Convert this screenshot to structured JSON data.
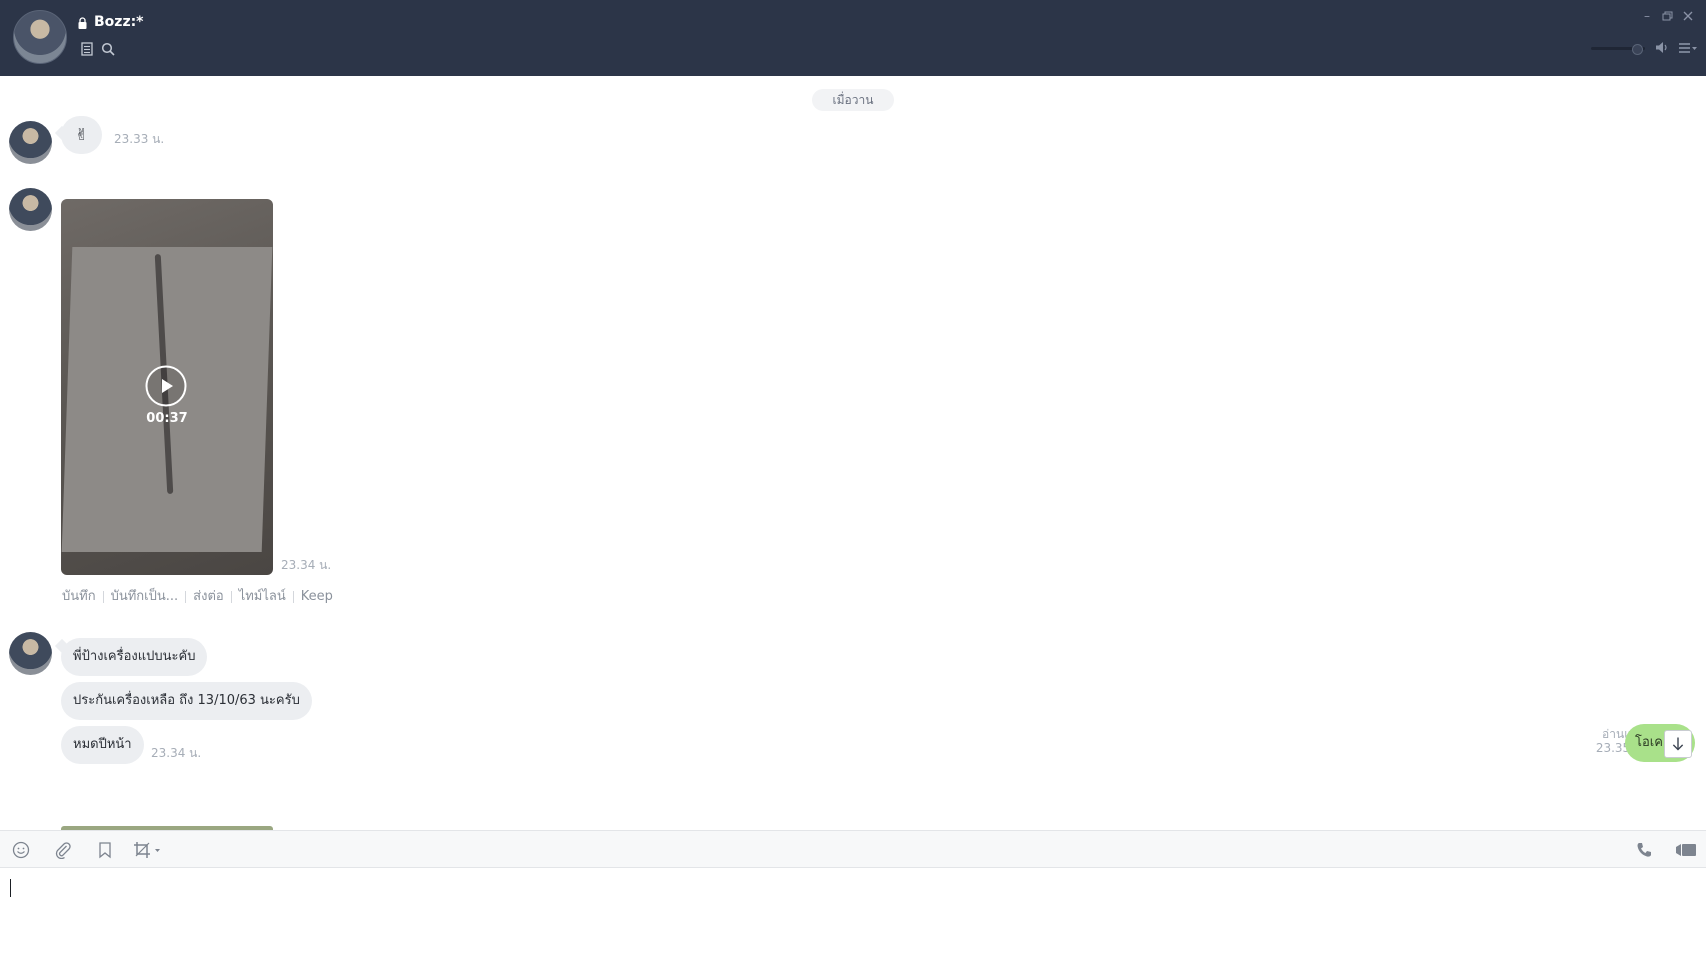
{
  "header": {
    "title": "Bozz:*",
    "window_controls": [
      "minimize-icon",
      "restore-icon",
      "close-icon"
    ],
    "volume_level": 0.85
  },
  "messages": {
    "date_separator": "เมื่อวาน",
    "items": [
      {
        "type": "sticker",
        "text": "✌",
        "time": "23.33 น."
      },
      {
        "type": "video",
        "duration": "00:37",
        "time": "23.34 น.",
        "actions": [
          "บันทึก",
          "บันทึกเป็น...",
          "ส่งต่อ",
          "ไทม์ไลน์",
          "Keep"
        ]
      },
      {
        "type": "text",
        "text": "พี่ป้างเครื่องแปบนะคับ"
      },
      {
        "type": "text",
        "text": "ประกันเครื่องเหลือ ถึง 13/10/63 นะครับ"
      },
      {
        "type": "text",
        "text": "หมดปีหน้า",
        "time": "23.34 น."
      },
      {
        "type": "outgoing",
        "text": "โอเค",
        "read": "อ่านแล้ว",
        "time": "23.35 น."
      }
    ]
  },
  "toolbar": {
    "left_icons": [
      "smiley-icon",
      "paperclip-icon",
      "bookmark-icon",
      "crop-icon"
    ],
    "right_icons": [
      "phone-icon",
      "video-call-icon"
    ]
  },
  "input": {
    "value": ""
  },
  "colors": {
    "header_bg": "#2c3548",
    "incoming_bubble": "#eceef1",
    "outgoing_bubble": "#a9e18a"
  }
}
